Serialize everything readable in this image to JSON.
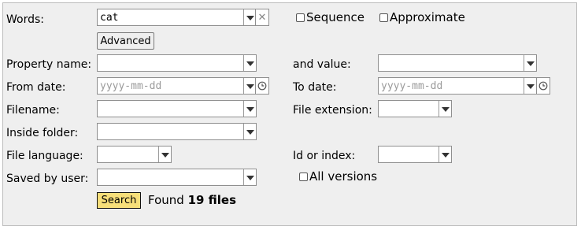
{
  "labels": {
    "words": "Words:",
    "property_name": "Property name:",
    "and_value": "and value:",
    "from_date": "From date:",
    "to_date": "To date:",
    "filename": "Filename:",
    "file_extension": "File extension:",
    "inside_folder": "Inside folder:",
    "file_language": "File language:",
    "id_or_index": "Id or index:",
    "saved_by_user": "Saved by user:"
  },
  "words": {
    "value": "cat"
  },
  "date": {
    "placeholder": "yyyy-mm-dd"
  },
  "checkboxes": {
    "sequence": {
      "label": "Sequence",
      "checked": false
    },
    "approximate": {
      "label": "Approximate",
      "checked": false
    },
    "all_versions": {
      "label": "All versions",
      "checked": false
    }
  },
  "buttons": {
    "advanced": "Advanced",
    "search": "Search"
  },
  "result": {
    "prefix": "Found ",
    "count": "19",
    "suffix": " files"
  },
  "icons": {
    "clear": "close-icon",
    "date_picker": "clock-icon",
    "dropdown": "chevron-down-icon"
  }
}
